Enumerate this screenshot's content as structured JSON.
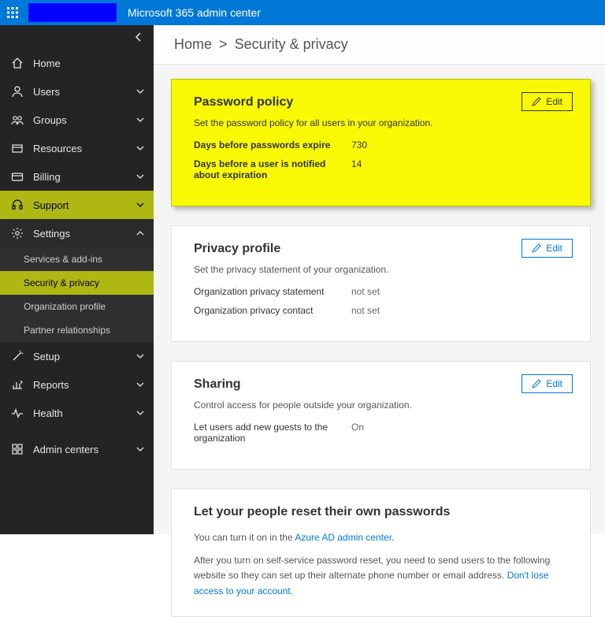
{
  "header": {
    "app_title": "Microsoft 365 admin center"
  },
  "breadcrumb": {
    "root": "Home",
    "sep": ">",
    "page": "Security & privacy"
  },
  "sidebar": {
    "items": [
      {
        "label": "Home"
      },
      {
        "label": "Users"
      },
      {
        "label": "Groups"
      },
      {
        "label": "Resources"
      },
      {
        "label": "Billing"
      },
      {
        "label": "Support"
      },
      {
        "label": "Settings"
      },
      {
        "label": "Setup"
      },
      {
        "label": "Reports"
      },
      {
        "label": "Health"
      },
      {
        "label": "Admin centers"
      }
    ],
    "settings_children": [
      {
        "label": "Services & add-ins"
      },
      {
        "label": "Security & privacy"
      },
      {
        "label": "Organization profile"
      },
      {
        "label": "Partner relationships"
      }
    ]
  },
  "cards": {
    "password": {
      "title": "Password policy",
      "desc": "Set the password policy for all users in your organization.",
      "rows": [
        {
          "k": "Days before passwords expire",
          "v": "730"
        },
        {
          "k": "Days before a user is notified about expiration",
          "v": "14"
        }
      ],
      "edit": "Edit"
    },
    "privacy": {
      "title": "Privacy profile",
      "desc": "Set the privacy statement of your organization.",
      "rows": [
        {
          "k": "Organization privacy statement",
          "v": "not set"
        },
        {
          "k": "Organization privacy contact",
          "v": "not set"
        }
      ],
      "edit": "Edit"
    },
    "sharing": {
      "title": "Sharing",
      "desc": "Control access for people outside your organization.",
      "rows": [
        {
          "k": "Let users add new guests to the organization",
          "v": "On"
        }
      ],
      "edit": "Edit"
    },
    "sspr": {
      "title": "Let your people reset their own passwords",
      "line1_a": "You can turn it on in the ",
      "line1_link": "Azure AD admin center",
      "line1_b": ".",
      "line2_a": "After you turn on self-service password reset, you need to send users to the following website so they can set up their alternate phone number or email address. ",
      "line2_link": "Don't lose access to your account",
      "line2_b": "."
    }
  }
}
